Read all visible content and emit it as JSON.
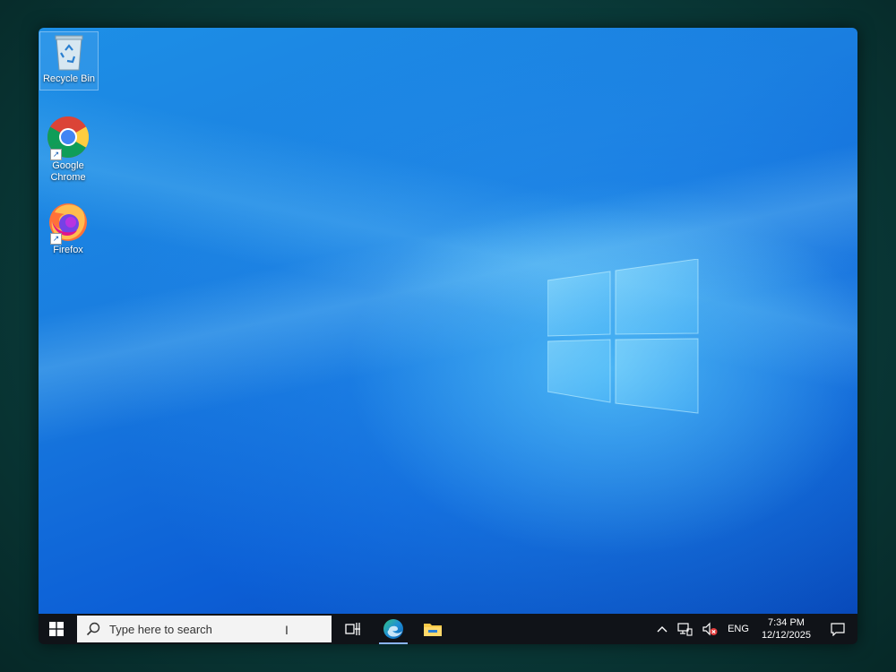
{
  "desktop": {
    "icons": [
      {
        "label": "Recycle Bin",
        "icon": "recycle-bin-icon",
        "selected": true
      },
      {
        "label": "Google Chrome",
        "icon": "chrome-icon",
        "shortcut": true
      },
      {
        "label": "Firefox",
        "icon": "firefox-icon",
        "shortcut": true
      }
    ]
  },
  "taskbar": {
    "search_placeholder": "Type here to search",
    "pinned": [
      {
        "name": "Task View",
        "icon": "task-view-icon"
      },
      {
        "name": "Microsoft Edge",
        "icon": "edge-icon",
        "active": true
      },
      {
        "name": "File Explorer",
        "icon": "folder-icon"
      }
    ],
    "tray": {
      "language": "ENG",
      "time": "7:34 PM",
      "date": "12/12/2025",
      "volume_muted": true
    }
  },
  "colors": {
    "taskbar": "#101318",
    "desktop_accent": "#1a7ee0"
  }
}
